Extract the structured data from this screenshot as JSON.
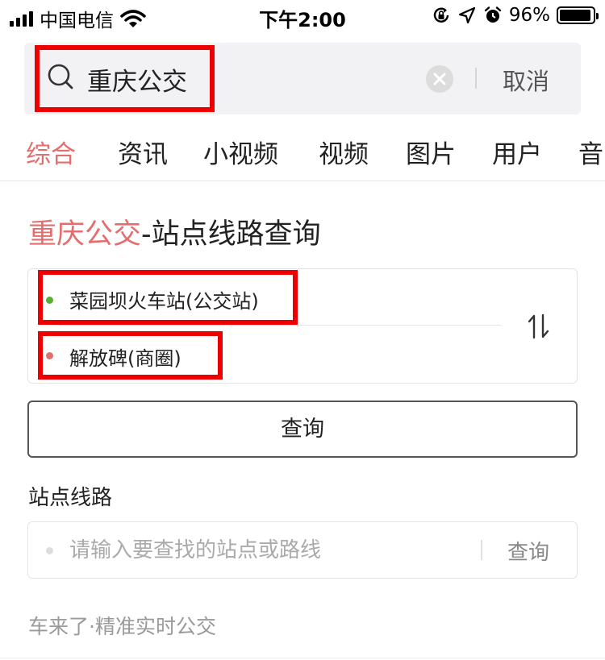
{
  "status_bar": {
    "carrier": "中国电信",
    "time": "下午2:00",
    "battery_percent": "96%",
    "battery_level": 0.96,
    "icons": [
      "signal-icon",
      "wifi-icon",
      "rotation-lock-icon",
      "location-arrow-icon",
      "alarm-icon",
      "battery-icon"
    ]
  },
  "search": {
    "query": "重庆公交",
    "cancel_label": "取消",
    "icons": [
      "search-icon",
      "clear-icon"
    ]
  },
  "tabs": [
    {
      "label": "综合",
      "active": true
    },
    {
      "label": "资讯",
      "active": false
    },
    {
      "label": "小视频",
      "active": false
    },
    {
      "label": "视频",
      "active": false
    },
    {
      "label": "图片",
      "active": false
    },
    {
      "label": "用户",
      "active": false
    },
    {
      "label": "音",
      "active": false
    }
  ],
  "card": {
    "title_highlight": "重庆公交",
    "title_rest": "-站点线路查询",
    "from_station": "菜园坝火车站(公交站)",
    "to_station": "解放碑(商圈)",
    "swap_icon": "swap-icon",
    "query_label": "查询",
    "colors": {
      "accent": "#e46d6d",
      "from_dot": "#55b132",
      "to_dot": "#e46d6d",
      "highlight_box": "#ee0000"
    }
  },
  "line_search": {
    "section_title": "站点线路",
    "placeholder": "请输入要查找的站点或路线",
    "button_label": "查询"
  },
  "footer": {
    "text": "车来了·精准实时公交"
  }
}
